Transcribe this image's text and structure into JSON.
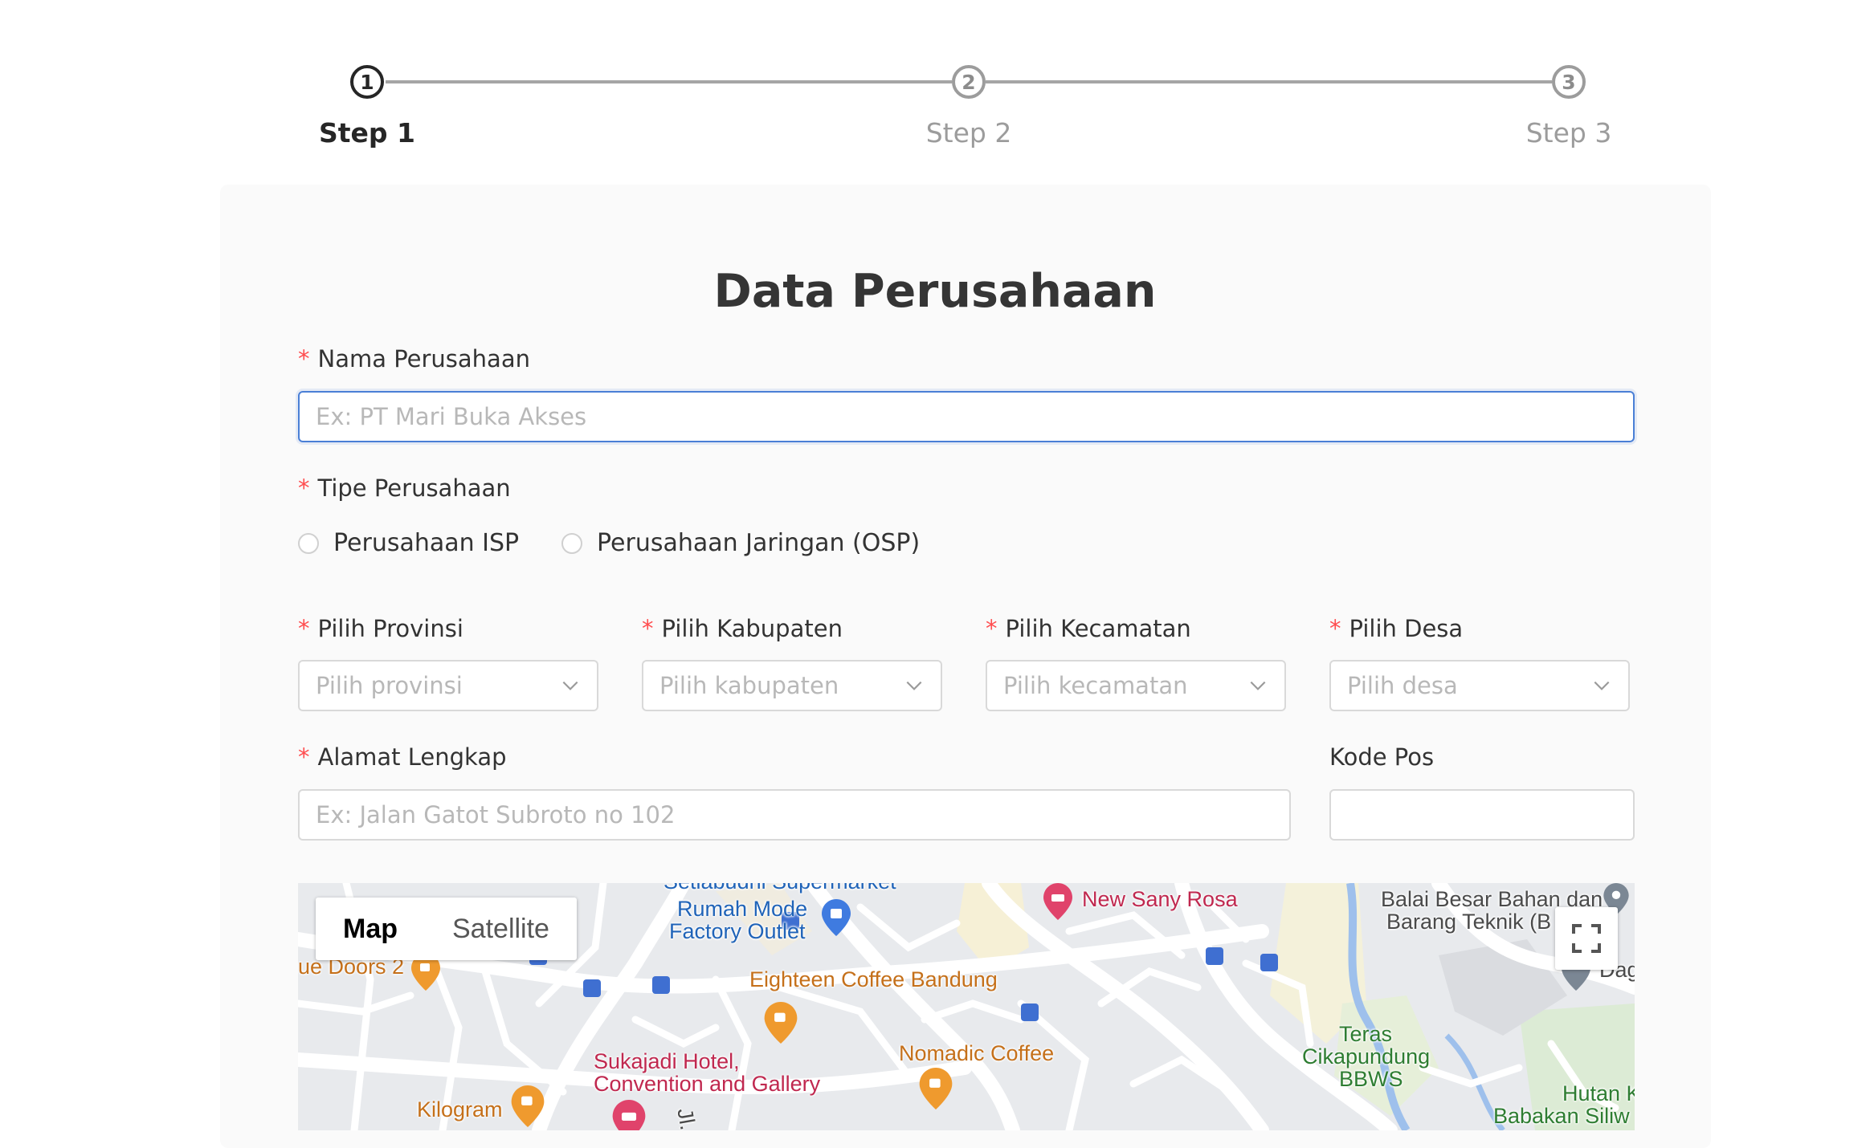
{
  "stepper": {
    "steps": [
      {
        "number": "1",
        "label": "Step 1"
      },
      {
        "number": "2",
        "label": "Step 2"
      },
      {
        "number": "3",
        "label": "Step 3"
      }
    ]
  },
  "form": {
    "title": "Data Perusahaan",
    "required_mark": "*",
    "company_name": {
      "label": "Nama Perusahaan",
      "placeholder": "Ex: PT Mari Buka Akses",
      "value": ""
    },
    "company_type": {
      "label": "Tipe Perusahaan",
      "options": [
        "Perusahaan ISP",
        "Perusahaan Jaringan (OSP)"
      ]
    },
    "province": {
      "label": "Pilih Provinsi",
      "placeholder": "Pilih provinsi"
    },
    "regency": {
      "label": "Pilih Kabupaten",
      "placeholder": "Pilih kabupaten"
    },
    "district": {
      "label": "Pilih Kecamatan",
      "placeholder": "Pilih kecamatan"
    },
    "village": {
      "label": "Pilih Desa",
      "placeholder": "Pilih desa"
    },
    "address": {
      "label": "Alamat Lengkap",
      "placeholder": "Ex: Jalan Gatot Subroto no 102",
      "value": ""
    },
    "postal_code": {
      "label": "Kode Pos",
      "value": ""
    }
  },
  "map": {
    "type_buttons": {
      "map": "Map",
      "satellite": "Satellite"
    },
    "places": {
      "rumah_mode_1": "Rumah Mode",
      "rumah_mode_2": "Factory Outlet",
      "setiabudi": "Setiabudhi Supermarket",
      "new_sany_rosa": "New Sany Rosa",
      "balai_1": "Balai Besar Bahan dan",
      "balai_2": "Barang Teknik (B",
      "blue_doors": "ue Doors 2",
      "eighteen": "Eighteen Coffee Bandung",
      "nomadic": "Nomadic Coffee",
      "sukajadi_1": "Sukajadi Hotel,",
      "sukajadi_2": "Convention and Gallery",
      "kilogram": "Kilogram",
      "teras_1": "Teras",
      "teras_2": "Cikapundung",
      "teras_3": "BBWS",
      "hutan": "Hutan K",
      "babakan": "Babakan Siliw",
      "dag": "Dag",
      "jl": "Jl."
    }
  }
}
